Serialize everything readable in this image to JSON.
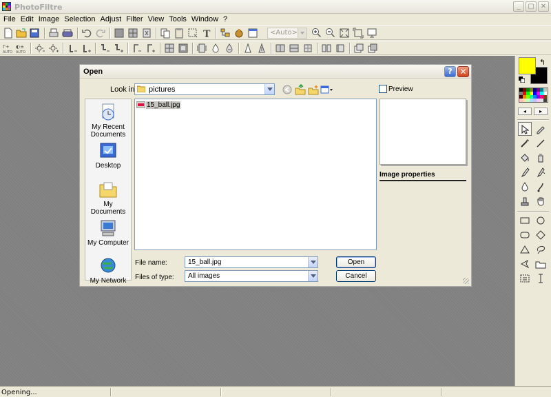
{
  "app": {
    "title": "PhotoFiltre",
    "window_buttons": [
      "_",
      "▢",
      "✕"
    ]
  },
  "menu": [
    "File",
    "Edit",
    "Image",
    "Selection",
    "Adjust",
    "Filter",
    "View",
    "Tools",
    "Window",
    "?"
  ],
  "toolbar": {
    "zoom_value": "<Auto>"
  },
  "palette": {
    "foreground_color": "#FFFF00",
    "background_color": "#000000",
    "prev_label": "◂",
    "next_label": "▸"
  },
  "dialog": {
    "title": "Open",
    "help_label": "?",
    "close_label": "✕",
    "look_in_label": "Look in:",
    "look_in_value": "pictures",
    "places": [
      "My Recent Documents",
      "Desktop",
      "My Documents",
      "My Computer",
      "My Network"
    ],
    "files": [
      "15_ball.jpg"
    ],
    "file_name_label": "File name:",
    "file_name_value": "15_ball.jpg",
    "file_type_label": "Files of type:",
    "file_type_value": "All images",
    "open_button": "Open",
    "cancel_button": "Cancel",
    "preview_label": "Preview",
    "image_properties_label": "Image properties"
  },
  "status": {
    "text": "Opening..."
  }
}
